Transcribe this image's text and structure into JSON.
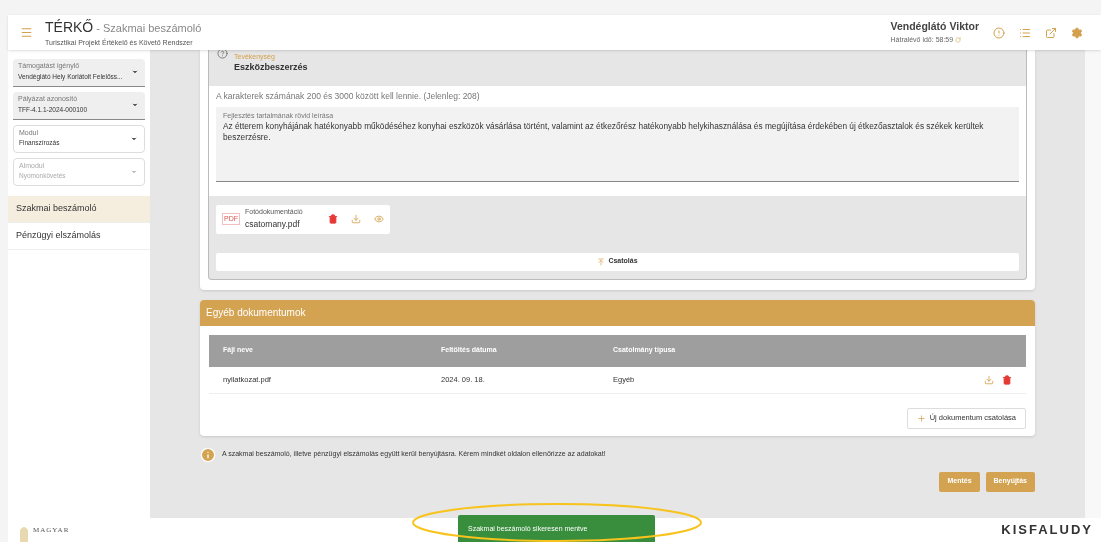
{
  "header": {
    "title": "TÉRKŐ",
    "subtitle": "- Szakmai beszámoló",
    "tagline": "Turisztikai Projekt Értékelő és Követő Rendszer",
    "user": "Vendéglátó Viktor",
    "timer": "Hátralévő idő: 58:59"
  },
  "sidebar": {
    "fields": [
      {
        "kind": "filled",
        "label": "Támogatást igénylő",
        "value": "Vendéglátó Hely Korlátolt Felelőss...",
        "disabled": false
      },
      {
        "kind": "filled",
        "label": "Pályázat azonosító",
        "value": "TFF-4.1.1-2024-000100",
        "disabled": false
      },
      {
        "kind": "outlined",
        "label": "Modul",
        "value": "Finanszírozás",
        "disabled": false
      },
      {
        "kind": "outlined",
        "label": "Almodul",
        "value": "Nyomonkövetés",
        "disabled": true
      }
    ],
    "nav": [
      {
        "label": "Szakmai beszámoló",
        "selected": true
      },
      {
        "label": "Pénzügyi elszámolás",
        "selected": false
      }
    ]
  },
  "activity": {
    "label": "Tevékenység",
    "title": "Eszközbeszerzés",
    "hint": "A karakterek számának 200 és 3000 között kell lennie. (Jelenleg: 208)",
    "description_label": "Fejlesztés tartalmának rövid leírása",
    "description": "Az étterem konyhájának hatékonyabb működéséhez konyhai eszközök vásárlása történt, valamint az étkezőrész hatékonyabb helykihasználása és megújítása érdekében új étkezőasztalok és székek kerültek beszerzésre.",
    "attachment": {
      "type": "PDF",
      "label": "Fotódokumentáció",
      "file": "csatomany.pdf"
    },
    "attach_button": "Csatolás"
  },
  "other_documents": {
    "title": "Egyéb dokumentumok",
    "columns": [
      "Fájl neve",
      "Feltöltés dátuma",
      "Csatolmány típusa"
    ],
    "rows": [
      [
        "nyilatkozat.pdf",
        "2024. 09. 18.",
        "Egyéb"
      ]
    ],
    "add_button": "Új dokumentum csatolása"
  },
  "notice": "A szakmai beszámoló, illetve pénzügyi elszámolás együtt kerül benyújtásra. Kérem mindkét oldalon ellenőrizze az adatokat!",
  "buttons": [
    "Mentés",
    "Benyújtás"
  ],
  "toast": "Szakmai beszámoló sikeresen mentve",
  "footer": {
    "left_logo": "MAGYAR",
    "right_logo": "KISFALUDY"
  }
}
